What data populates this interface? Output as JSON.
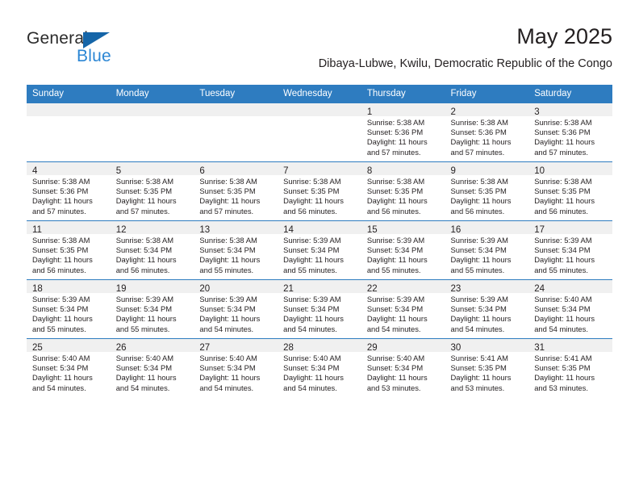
{
  "brand": {
    "name_top": "General",
    "name_bottom": "Blue",
    "triangle_color": "#1565a8",
    "blue_text_color": "#2b86d4"
  },
  "header": {
    "title": "May 2025",
    "subtitle": "Dibaya-Lubwe, Kwilu, Democratic Republic of the Congo"
  },
  "theme": {
    "header_row_bg": "#2e7cc0",
    "date_strip_bg": "#f0f0f0",
    "text_color": "#231f20"
  },
  "weekday_headers": [
    "Sunday",
    "Monday",
    "Tuesday",
    "Wednesday",
    "Thursday",
    "Friday",
    "Saturday"
  ],
  "weeks": [
    [
      {
        "day": "",
        "empty": true,
        "sunrise": "",
        "sunset": "",
        "daylight_line1": "",
        "daylight_line2": ""
      },
      {
        "day": "",
        "empty": true,
        "sunrise": "",
        "sunset": "",
        "daylight_line1": "",
        "daylight_line2": ""
      },
      {
        "day": "",
        "empty": true,
        "sunrise": "",
        "sunset": "",
        "daylight_line1": "",
        "daylight_line2": ""
      },
      {
        "day": "",
        "empty": true,
        "sunrise": "",
        "sunset": "",
        "daylight_line1": "",
        "daylight_line2": ""
      },
      {
        "day": "1",
        "empty": false,
        "sunrise": "Sunrise: 5:38 AM",
        "sunset": "Sunset: 5:36 PM",
        "daylight_line1": "Daylight: 11 hours",
        "daylight_line2": "and 57 minutes."
      },
      {
        "day": "2",
        "empty": false,
        "sunrise": "Sunrise: 5:38 AM",
        "sunset": "Sunset: 5:36 PM",
        "daylight_line1": "Daylight: 11 hours",
        "daylight_line2": "and 57 minutes."
      },
      {
        "day": "3",
        "empty": false,
        "sunrise": "Sunrise: 5:38 AM",
        "sunset": "Sunset: 5:36 PM",
        "daylight_line1": "Daylight: 11 hours",
        "daylight_line2": "and 57 minutes."
      }
    ],
    [
      {
        "day": "4",
        "empty": false,
        "sunrise": "Sunrise: 5:38 AM",
        "sunset": "Sunset: 5:36 PM",
        "daylight_line1": "Daylight: 11 hours",
        "daylight_line2": "and 57 minutes."
      },
      {
        "day": "5",
        "empty": false,
        "sunrise": "Sunrise: 5:38 AM",
        "sunset": "Sunset: 5:35 PM",
        "daylight_line1": "Daylight: 11 hours",
        "daylight_line2": "and 57 minutes."
      },
      {
        "day": "6",
        "empty": false,
        "sunrise": "Sunrise: 5:38 AM",
        "sunset": "Sunset: 5:35 PM",
        "daylight_line1": "Daylight: 11 hours",
        "daylight_line2": "and 57 minutes."
      },
      {
        "day": "7",
        "empty": false,
        "sunrise": "Sunrise: 5:38 AM",
        "sunset": "Sunset: 5:35 PM",
        "daylight_line1": "Daylight: 11 hours",
        "daylight_line2": "and 56 minutes."
      },
      {
        "day": "8",
        "empty": false,
        "sunrise": "Sunrise: 5:38 AM",
        "sunset": "Sunset: 5:35 PM",
        "daylight_line1": "Daylight: 11 hours",
        "daylight_line2": "and 56 minutes."
      },
      {
        "day": "9",
        "empty": false,
        "sunrise": "Sunrise: 5:38 AM",
        "sunset": "Sunset: 5:35 PM",
        "daylight_line1": "Daylight: 11 hours",
        "daylight_line2": "and 56 minutes."
      },
      {
        "day": "10",
        "empty": false,
        "sunrise": "Sunrise: 5:38 AM",
        "sunset": "Sunset: 5:35 PM",
        "daylight_line1": "Daylight: 11 hours",
        "daylight_line2": "and 56 minutes."
      }
    ],
    [
      {
        "day": "11",
        "empty": false,
        "sunrise": "Sunrise: 5:38 AM",
        "sunset": "Sunset: 5:35 PM",
        "daylight_line1": "Daylight: 11 hours",
        "daylight_line2": "and 56 minutes."
      },
      {
        "day": "12",
        "empty": false,
        "sunrise": "Sunrise: 5:38 AM",
        "sunset": "Sunset: 5:34 PM",
        "daylight_line1": "Daylight: 11 hours",
        "daylight_line2": "and 56 minutes."
      },
      {
        "day": "13",
        "empty": false,
        "sunrise": "Sunrise: 5:38 AM",
        "sunset": "Sunset: 5:34 PM",
        "daylight_line1": "Daylight: 11 hours",
        "daylight_line2": "and 55 minutes."
      },
      {
        "day": "14",
        "empty": false,
        "sunrise": "Sunrise: 5:39 AM",
        "sunset": "Sunset: 5:34 PM",
        "daylight_line1": "Daylight: 11 hours",
        "daylight_line2": "and 55 minutes."
      },
      {
        "day": "15",
        "empty": false,
        "sunrise": "Sunrise: 5:39 AM",
        "sunset": "Sunset: 5:34 PM",
        "daylight_line1": "Daylight: 11 hours",
        "daylight_line2": "and 55 minutes."
      },
      {
        "day": "16",
        "empty": false,
        "sunrise": "Sunrise: 5:39 AM",
        "sunset": "Sunset: 5:34 PM",
        "daylight_line1": "Daylight: 11 hours",
        "daylight_line2": "and 55 minutes."
      },
      {
        "day": "17",
        "empty": false,
        "sunrise": "Sunrise: 5:39 AM",
        "sunset": "Sunset: 5:34 PM",
        "daylight_line1": "Daylight: 11 hours",
        "daylight_line2": "and 55 minutes."
      }
    ],
    [
      {
        "day": "18",
        "empty": false,
        "sunrise": "Sunrise: 5:39 AM",
        "sunset": "Sunset: 5:34 PM",
        "daylight_line1": "Daylight: 11 hours",
        "daylight_line2": "and 55 minutes."
      },
      {
        "day": "19",
        "empty": false,
        "sunrise": "Sunrise: 5:39 AM",
        "sunset": "Sunset: 5:34 PM",
        "daylight_line1": "Daylight: 11 hours",
        "daylight_line2": "and 55 minutes."
      },
      {
        "day": "20",
        "empty": false,
        "sunrise": "Sunrise: 5:39 AM",
        "sunset": "Sunset: 5:34 PM",
        "daylight_line1": "Daylight: 11 hours",
        "daylight_line2": "and 54 minutes."
      },
      {
        "day": "21",
        "empty": false,
        "sunrise": "Sunrise: 5:39 AM",
        "sunset": "Sunset: 5:34 PM",
        "daylight_line1": "Daylight: 11 hours",
        "daylight_line2": "and 54 minutes."
      },
      {
        "day": "22",
        "empty": false,
        "sunrise": "Sunrise: 5:39 AM",
        "sunset": "Sunset: 5:34 PM",
        "daylight_line1": "Daylight: 11 hours",
        "daylight_line2": "and 54 minutes."
      },
      {
        "day": "23",
        "empty": false,
        "sunrise": "Sunrise: 5:39 AM",
        "sunset": "Sunset: 5:34 PM",
        "daylight_line1": "Daylight: 11 hours",
        "daylight_line2": "and 54 minutes."
      },
      {
        "day": "24",
        "empty": false,
        "sunrise": "Sunrise: 5:40 AM",
        "sunset": "Sunset: 5:34 PM",
        "daylight_line1": "Daylight: 11 hours",
        "daylight_line2": "and 54 minutes."
      }
    ],
    [
      {
        "day": "25",
        "empty": false,
        "sunrise": "Sunrise: 5:40 AM",
        "sunset": "Sunset: 5:34 PM",
        "daylight_line1": "Daylight: 11 hours",
        "daylight_line2": "and 54 minutes."
      },
      {
        "day": "26",
        "empty": false,
        "sunrise": "Sunrise: 5:40 AM",
        "sunset": "Sunset: 5:34 PM",
        "daylight_line1": "Daylight: 11 hours",
        "daylight_line2": "and 54 minutes."
      },
      {
        "day": "27",
        "empty": false,
        "sunrise": "Sunrise: 5:40 AM",
        "sunset": "Sunset: 5:34 PM",
        "daylight_line1": "Daylight: 11 hours",
        "daylight_line2": "and 54 minutes."
      },
      {
        "day": "28",
        "empty": false,
        "sunrise": "Sunrise: 5:40 AM",
        "sunset": "Sunset: 5:34 PM",
        "daylight_line1": "Daylight: 11 hours",
        "daylight_line2": "and 54 minutes."
      },
      {
        "day": "29",
        "empty": false,
        "sunrise": "Sunrise: 5:40 AM",
        "sunset": "Sunset: 5:34 PM",
        "daylight_line1": "Daylight: 11 hours",
        "daylight_line2": "and 53 minutes."
      },
      {
        "day": "30",
        "empty": false,
        "sunrise": "Sunrise: 5:41 AM",
        "sunset": "Sunset: 5:35 PM",
        "daylight_line1": "Daylight: 11 hours",
        "daylight_line2": "and 53 minutes."
      },
      {
        "day": "31",
        "empty": false,
        "sunrise": "Sunrise: 5:41 AM",
        "sunset": "Sunset: 5:35 PM",
        "daylight_line1": "Daylight: 11 hours",
        "daylight_line2": "and 53 minutes."
      }
    ]
  ]
}
